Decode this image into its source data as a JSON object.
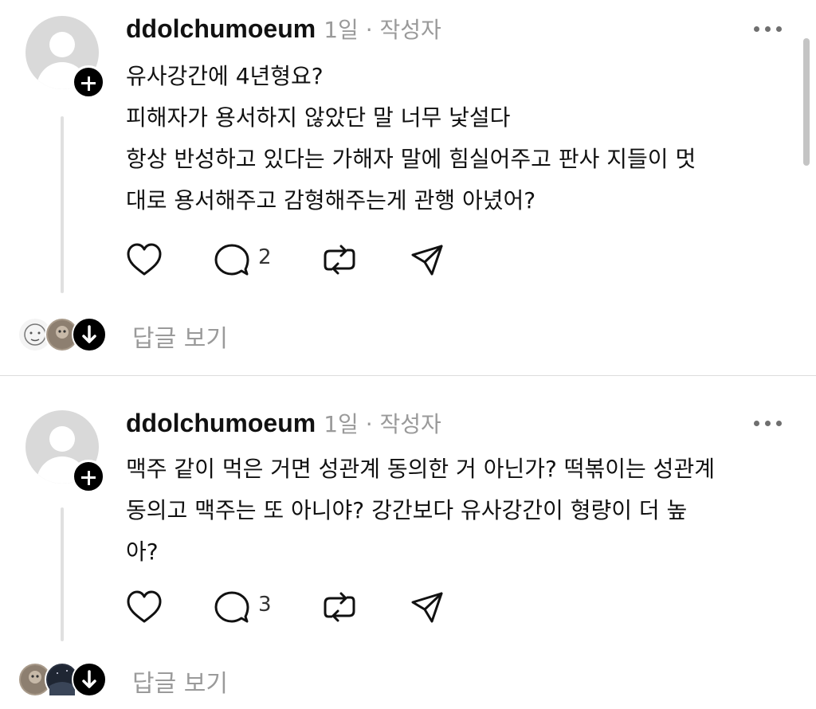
{
  "posts": [
    {
      "username": "ddolchumoeum",
      "meta": "1일 · 작성자",
      "lines": [
        "유사강간에 4년형요?",
        "피해자가 용서하지 않았단 말 너무 낯설다",
        "항상 반성하고 있다는 가해자 말에 힘실어주고 판사 지들이 멋",
        "대로 용서해주고 감형해주는게 관행 아녔어?"
      ],
      "comment_count": "2",
      "view_replies": "답글 보기"
    },
    {
      "username": "ddolchumoeum",
      "meta": "1일 · 작성자",
      "lines": [
        "맥주 같이 먹은 거면 성관계 동의한 거 아닌가? 떡볶이는 성관계",
        "동의고 맥주는 또 아니야? 강간보다 유사강간이 형량이 더 높",
        "아?"
      ],
      "comment_count": "3",
      "view_replies": "답글 보기"
    }
  ],
  "icons": {
    "like": "heart-icon",
    "comment": "comment-bubble-icon",
    "repost": "repost-icon",
    "share": "send-icon",
    "more": "more-dots-icon",
    "follow": "plus-icon",
    "expand": "arrow-down-icon"
  },
  "colors": {
    "meta_gray": "#9a9a9a",
    "divider": "#dcdcdc",
    "avatar_placeholder": "#d9d9d9"
  }
}
